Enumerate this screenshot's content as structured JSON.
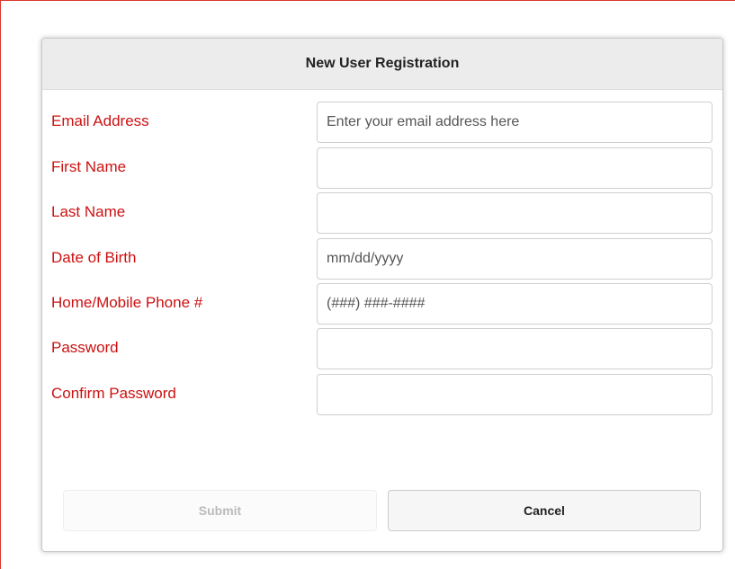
{
  "dialog": {
    "title": "New User Registration"
  },
  "form": {
    "fields": [
      {
        "label": "Email Address",
        "placeholder": "Enter your email address here",
        "value": ""
      },
      {
        "label": "First Name",
        "placeholder": "",
        "value": ""
      },
      {
        "label": "Last Name",
        "placeholder": "",
        "value": ""
      },
      {
        "label": "Date of Birth",
        "placeholder": "mm/dd/yyyy",
        "value": ""
      },
      {
        "label": "Home/Mobile Phone #",
        "placeholder": "(###) ###-####",
        "value": ""
      },
      {
        "label": "Password",
        "placeholder": "",
        "value": ""
      },
      {
        "label": "Confirm Password",
        "placeholder": "",
        "value": ""
      }
    ]
  },
  "buttons": {
    "submit_label": "Submit",
    "submit_disabled": true,
    "cancel_label": "Cancel"
  },
  "colors": {
    "label": "#cc1111",
    "frame_border": "#d9372e",
    "header_bg": "#ececec"
  }
}
